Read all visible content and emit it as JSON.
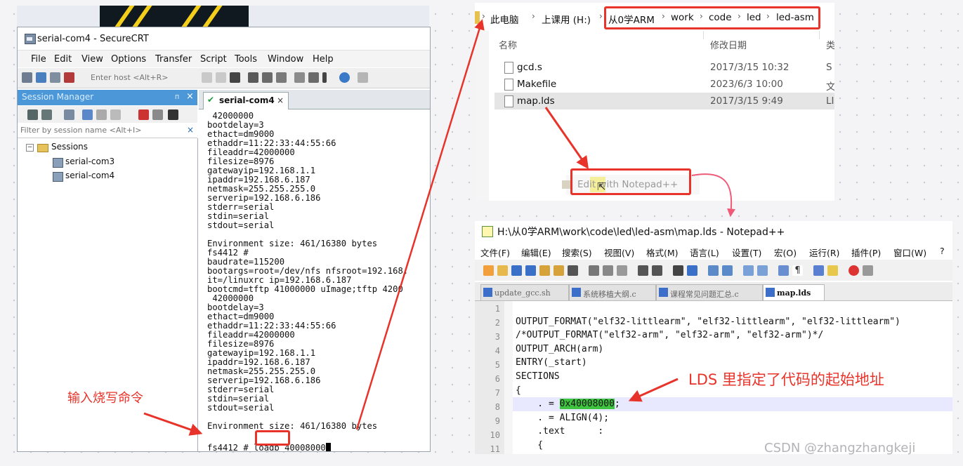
{
  "securecrt": {
    "window_title": "serial-com4 - SecureCRT",
    "menu": [
      "File",
      "Edit",
      "View",
      "Options",
      "Transfer",
      "Script",
      "Tools",
      "Window",
      "Help"
    ],
    "host_placeholder": "Enter host <Alt+R>",
    "session_manager": {
      "title": "Session Manager",
      "pin": "ᴨ",
      "close": "×",
      "filter_placeholder": "Filter by session name <Alt+I>",
      "filter_clear": "×",
      "root": "Sessions",
      "items": [
        "serial-com3",
        "serial-com4"
      ]
    },
    "tab": {
      "label": "serial-com4",
      "close": "×"
    },
    "terminal_lines": [
      " 42000000",
      "bootdelay=3",
      "ethact=dm9000",
      "ethaddr=11:22:33:44:55:66",
      "fileaddr=42000000",
      "filesize=8976",
      "gatewayip=192.168.1.1",
      "ipaddr=192.168.6.187",
      "netmask=255.255.255.0",
      "serverip=192.168.6.186",
      "stderr=serial",
      "stdin=serial",
      "stdout=serial",
      "",
      "Environment size: 461/16380 bytes",
      "fs4412 #",
      "baudrate=115200",
      "bootargs=root=/dev/nfs nfsroot=192.168.",
      "it=/linuxrc ip=192.168.6.187",
      "bootcmd=tftp 41000000 uImage;tftp 4200",
      " 42000000",
      "bootdelay=3",
      "ethact=dm9000",
      "ethaddr=11:22:33:44:55:66",
      "fileaddr=42000000",
      "filesize=8976",
      "gatewayip=192.168.1.1",
      "ipaddr=192.168.6.187",
      "netmask=255.255.255.0",
      "serverip=192.168.6.186",
      "stderr=serial",
      "stdin=serial",
      "stdout=serial",
      "",
      "Environment size: 461/16380 bytes"
    ],
    "prompt_prefix": "fs4412 # ",
    "prompt_command": "loadb",
    "prompt_arg": " 40008000"
  },
  "explorer": {
    "breadcrumb": [
      "此电脑",
      "上课用 (H:)",
      "从0学ARM",
      "work",
      "code",
      "led",
      "led-asm"
    ],
    "columns": {
      "name": "名称",
      "date": "修改日期",
      "type": "类"
    },
    "files": [
      {
        "name": "gcd.s",
        "date": "2017/3/15 10:32",
        "type": "S"
      },
      {
        "name": "Makefile",
        "date": "2023/6/3 10:00",
        "type": "文"
      },
      {
        "name": "map.lds",
        "date": "2017/3/15 9:49",
        "type": "LI"
      }
    ],
    "context_menu_item": "Edit with Notepad++"
  },
  "notepad": {
    "window_title": "H:\\从0学ARM\\work\\code\\led\\led-asm\\map.lds - Notepad++",
    "menu": [
      "文件(F)",
      "编辑(E)",
      "搜索(S)",
      "视图(V)",
      "格式(M)",
      "语言(L)",
      "设置(T)",
      "宏(O)",
      "运行(R)",
      "插件(P)",
      "窗口(W)",
      "?"
    ],
    "tabs": [
      "update_gcc.sh",
      "系统移植大纲.c",
      "课程常见问题汇总.c",
      "map.lds"
    ],
    "line_numbers": [
      "1",
      "2",
      "3",
      "4",
      "5",
      "6",
      "7",
      "8",
      "9",
      "10",
      "11"
    ],
    "code_lines": [
      "",
      "OUTPUT_FORMAT(\"elf32-littlearm\", \"elf32-littlearm\", \"elf32-littlearm\")",
      "/*OUTPUT_FORMAT(\"elf32-arm\", \"elf32-arm\", \"elf32-arm\")*/",
      "OUTPUT_ARCH(arm)",
      "ENTRY(_start)",
      "SECTIONS",
      "{",
      "",
      "    . = ALIGN(4);",
      "    .text      :",
      "    {"
    ],
    "line8_prefix": "    . = ",
    "line8_address": "0x40008000",
    "line8_suffix": ";"
  },
  "annotations": {
    "burn_command": "输入烧写命令",
    "lds_note": "LDS 里指定了代码的起始地址",
    "color": "#e8332a"
  },
  "watermark": "CSDN @zhangzhangkeji"
}
